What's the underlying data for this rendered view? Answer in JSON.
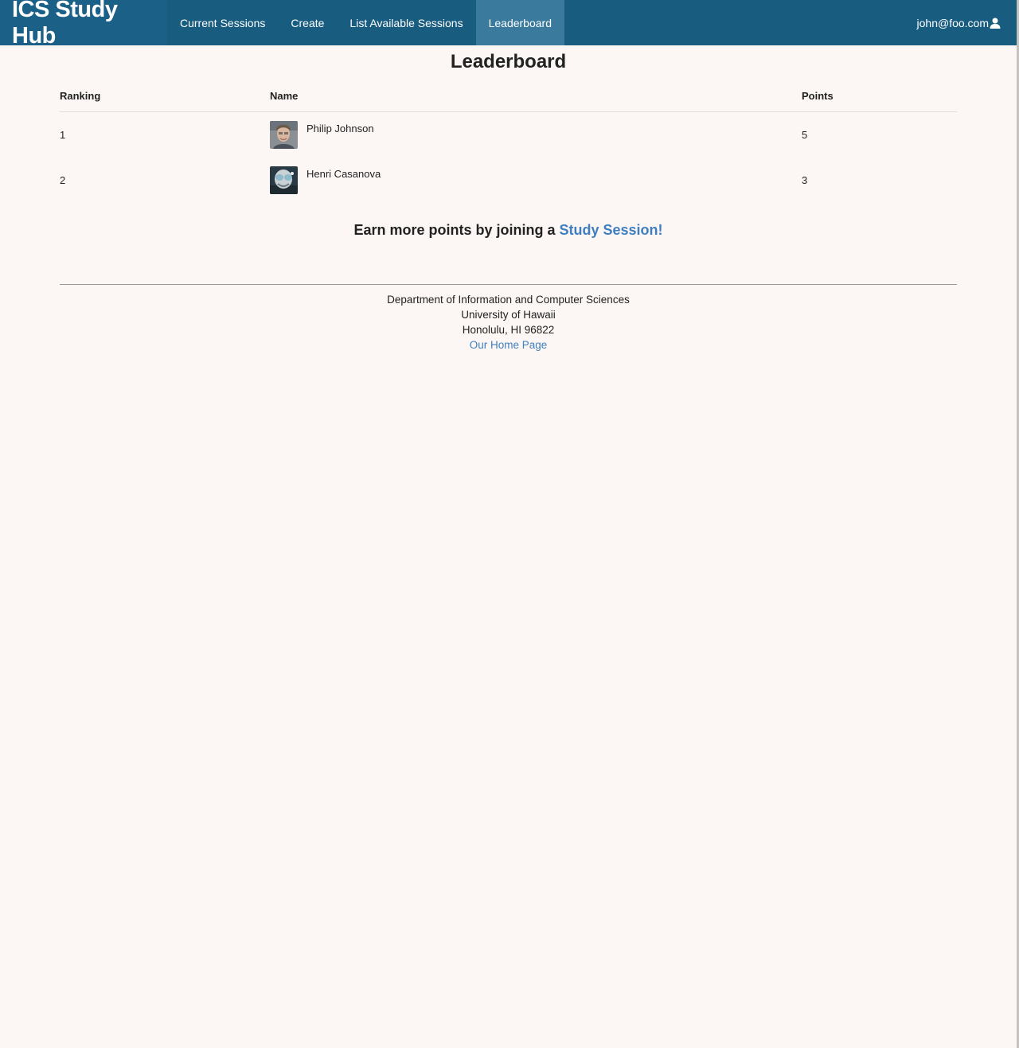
{
  "navbar": {
    "brand": "ICS Study Hub",
    "items": [
      {
        "label": "Current Sessions"
      },
      {
        "label": "Create"
      },
      {
        "label": "List Available Sessions"
      },
      {
        "label": "Leaderboard",
        "active": true
      }
    ],
    "user_email": "john@foo.com",
    "user_icon": "user-icon",
    "colors": {
      "bar": "#185c80",
      "active": "#3a7a9c"
    }
  },
  "page": {
    "title": "Leaderboard"
  },
  "table": {
    "headers": {
      "ranking": "Ranking",
      "name": "Name",
      "points": "Points"
    },
    "rows": [
      {
        "ranking": "1",
        "name": "Philip Johnson",
        "points": "5",
        "avatar": "philip-johnson-photo"
      },
      {
        "ranking": "2",
        "name": "Henri Casanova",
        "points": "3",
        "avatar": "henri-casanova-photo"
      }
    ]
  },
  "cta": {
    "text": "Earn more points by joining a ",
    "link_text": "Study Session!",
    "link_color": "#3f7fbf"
  },
  "footer": {
    "line1": "Department of Information and Computer Sciences",
    "line2": "University of Hawaii",
    "line3": "Honolulu, HI 96822",
    "link_text": "Our Home Page"
  }
}
